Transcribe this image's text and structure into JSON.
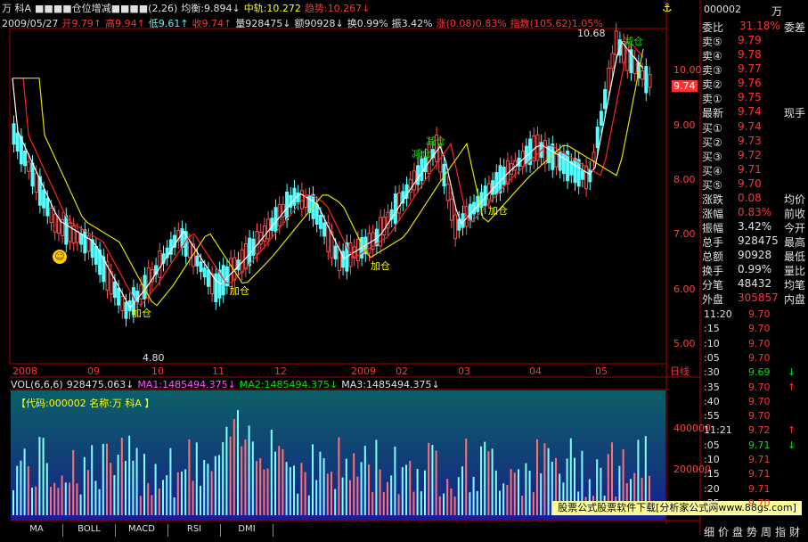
{
  "header": {
    "line1": [
      {
        "text": "万  科A",
        "color": "#e0e0e0"
      },
      {
        "text": "■■■■仓位增减■■■■(2,26)",
        "color": "#e0e0e0"
      },
      {
        "text": "均衡:9.894↓",
        "color": "#e0e0e0"
      },
      {
        "text": "中轨:10.272",
        "color": "#ffff00"
      },
      {
        "text": "趋势:10.267↓",
        "color": "#ff3232"
      }
    ],
    "line2": [
      {
        "text": "2009/05/27",
        "color": "#e0e0e0"
      },
      {
        "text": "开9.79↑",
        "color": "#ff3232"
      },
      {
        "text": "高9.94↑",
        "color": "#ff3232"
      },
      {
        "text": "低9.61↑",
        "color": "#54ffff"
      },
      {
        "text": "收9.74↑",
        "color": "#ff3232"
      },
      {
        "text": "量928475↓",
        "color": "#e0e0e0"
      },
      {
        "text": "额90928↓",
        "color": "#e0e0e0"
      },
      {
        "text": "换0.99%",
        "color": "#e0e0e0"
      },
      {
        "text": "振3.42%",
        "color": "#e0e0e0"
      },
      {
        "text": "涨(0.08)0.83%",
        "color": "#ff3232"
      },
      {
        "text": "指数(105.62)1.05%",
        "color": "#ff3232"
      }
    ]
  },
  "price_axis": {
    "labels": [
      "10.00",
      "9.00",
      "8.00",
      "7.00",
      "6.00",
      "5.00"
    ],
    "current": "9.74"
  },
  "annotations": {
    "high": "10.68",
    "low": "4.80",
    "add": "加仓",
    "reduce": "减仓"
  },
  "time_axis": {
    "labels": [
      "2008",
      "09",
      "10",
      "11",
      "12",
      "2009",
      "02",
      "03",
      "04",
      "05"
    ],
    "period": "日线"
  },
  "volume_header": [
    {
      "text": "VOL(6,6,6)",
      "color": "#e0e0e0"
    },
    {
      "text": "928475.063↓",
      "color": "#e0e0e0"
    },
    {
      "text": "MA1:1485494.375↓",
      "color": "#ff54ff"
    },
    {
      "text": "MA2:1485494.375↓",
      "color": "#00e600"
    },
    {
      "text": "MA3:1485494.375↓",
      "color": "#e0e0e0"
    }
  ],
  "volume_panel": {
    "code_label": "【代码:000002 名称:万  科A 】",
    "axis": [
      "400000",
      "200000"
    ]
  },
  "bottom_tabs": [
    "MA",
    "BOLL",
    "MACD",
    "RSI",
    "DMI"
  ],
  "watermark": "股票公式股票软件下载[分析家公式网www.88gs.com]",
  "quote_panel": {
    "code": "000002",
    "name": "万",
    "weibi_label": "委比",
    "weibi_val": "31.18%",
    "weibi_extra": "委差",
    "asks": [
      {
        "label": "卖⑤",
        "price": "9.79"
      },
      {
        "label": "卖④",
        "price": "9.78"
      },
      {
        "label": "卖③",
        "price": "9.77"
      },
      {
        "label": "卖②",
        "price": "9.76"
      },
      {
        "label": "卖①",
        "price": "9.75"
      }
    ],
    "latest": {
      "label": "最新",
      "price": "9.74",
      "extra": "现手"
    },
    "bids": [
      {
        "label": "买①",
        "price": "9.74"
      },
      {
        "label": "买②",
        "price": "9.73"
      },
      {
        "label": "买③",
        "price": "9.72"
      },
      {
        "label": "买④",
        "price": "9.71"
      },
      {
        "label": "买⑤",
        "price": "9.70"
      }
    ],
    "stats": [
      {
        "label": "涨跌",
        "val": "0.08",
        "extra": "均价",
        "color": "#ff3232"
      },
      {
        "label": "涨幅",
        "val": "0.83%",
        "extra": "前收",
        "color": "#ff3232"
      },
      {
        "label": "振幅",
        "val": "3.42%",
        "extra": "今开",
        "color": "#e0e0e0"
      },
      {
        "label": "总手",
        "val": "928475",
        "extra": "最高",
        "color": "#e0e0e0"
      },
      {
        "label": "总额",
        "val": "90928",
        "extra": "最低",
        "color": "#e0e0e0"
      },
      {
        "label": "换手",
        "val": "0.99%",
        "extra": "量比",
        "color": "#e0e0e0"
      },
      {
        "label": "分笔",
        "val": "48432",
        "extra": "均笔",
        "color": "#e0e0e0"
      }
    ],
    "outer": {
      "label": "外盘",
      "val": "305857",
      "extra": "内盘"
    },
    "ticks": [
      {
        "time": "11:20",
        "price": "9.70",
        "arrow": "",
        "color": "#ff3232"
      },
      {
        "time": ":15",
        "price": "9.70",
        "arrow": "",
        "color": "#ff3232"
      },
      {
        "time": ":10",
        "price": "9.70",
        "arrow": "",
        "color": "#ff3232"
      },
      {
        "time": ":05",
        "price": "9.70",
        "arrow": "",
        "color": "#ff3232"
      },
      {
        "time": ":30",
        "price": "9.69",
        "arrow": "↓",
        "color": "#00e600"
      },
      {
        "time": ":35",
        "price": "9.70",
        "arrow": "↑",
        "color": "#ff3232"
      },
      {
        "time": ":40",
        "price": "9.70",
        "arrow": "",
        "color": "#ff3232"
      },
      {
        "time": ":55",
        "price": "9.70",
        "arrow": "",
        "color": "#ff3232"
      },
      {
        "time": "11:21",
        "price": "9.72",
        "arrow": "↑",
        "color": "#ff3232"
      },
      {
        "time": ":05",
        "price": "9.71",
        "arrow": "↓",
        "color": "#00e600"
      },
      {
        "time": ":10",
        "price": "9.71",
        "arrow": "",
        "color": "#ff3232"
      },
      {
        "time": ":15",
        "price": "9.71",
        "arrow": "",
        "color": "#ff3232"
      },
      {
        "time": ":20",
        "price": "9.71",
        "arrow": "",
        "color": "#ff3232"
      },
      {
        "time": ":25",
        "price": "9.70",
        "arrow": "",
        "color": "#ff3232"
      }
    ],
    "bottom_tabs": [
      "细",
      "价",
      "盘",
      "势",
      "周",
      "指",
      "财"
    ]
  }
}
